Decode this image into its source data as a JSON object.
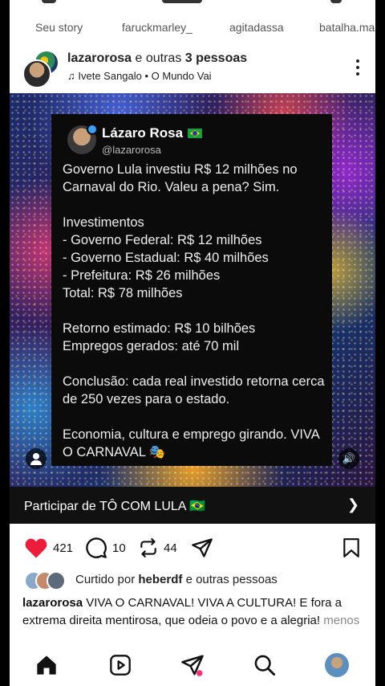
{
  "stories": [
    "Seu story",
    "faruckmarley_",
    "agitadassa",
    "batalha.ma"
  ],
  "post": {
    "username": "lazarorosa",
    "others_text": "e outras",
    "others_count": "3 pessoas",
    "music": "Ivete Sangalo • O Mundo Vai"
  },
  "tweet": {
    "name": "Lázaro Rosa",
    "handle": "@lazarorosa",
    "body": "Governo Lula investiu R$ 12 milhões no Carnaval do Rio. Valeu a pena? Sim.\n\nInvestimentos\n- Governo Federal: R$ 12 milhões\n- Governo Estadual: R$ 40 milhões\n- Prefeitura: R$ 26 milhões\nTotal: R$ 78 milhões\n\nRetorno estimado: R$ 10 bilhões\nEmpregos gerados: até 70 mil\n\nConclusão: cada real investido retorna cerca de 250 vezes para o estado.\n\nEconomia, cultura e emprego girando. VIVA O CARNAVAL 🎭"
  },
  "cta": {
    "label": "Participar de TÔ COM LULA 🇧🇷"
  },
  "actions": {
    "likes": "421",
    "comments": "10",
    "reposts": "44"
  },
  "liked_by": {
    "prefix": "Curtido por",
    "user": "heberdf",
    "suffix": "e outras pessoas"
  },
  "caption": {
    "username": "lazarorosa",
    "text": " VIVA O CARNAVAL! VIVA A CULTURA! E fora a extrema direita mentirosa, que odeia o povo e a alegria! ",
    "more": "menos"
  },
  "colors": {
    "like": "#ed1c3b",
    "nav_dot": "#ff2d6f"
  }
}
